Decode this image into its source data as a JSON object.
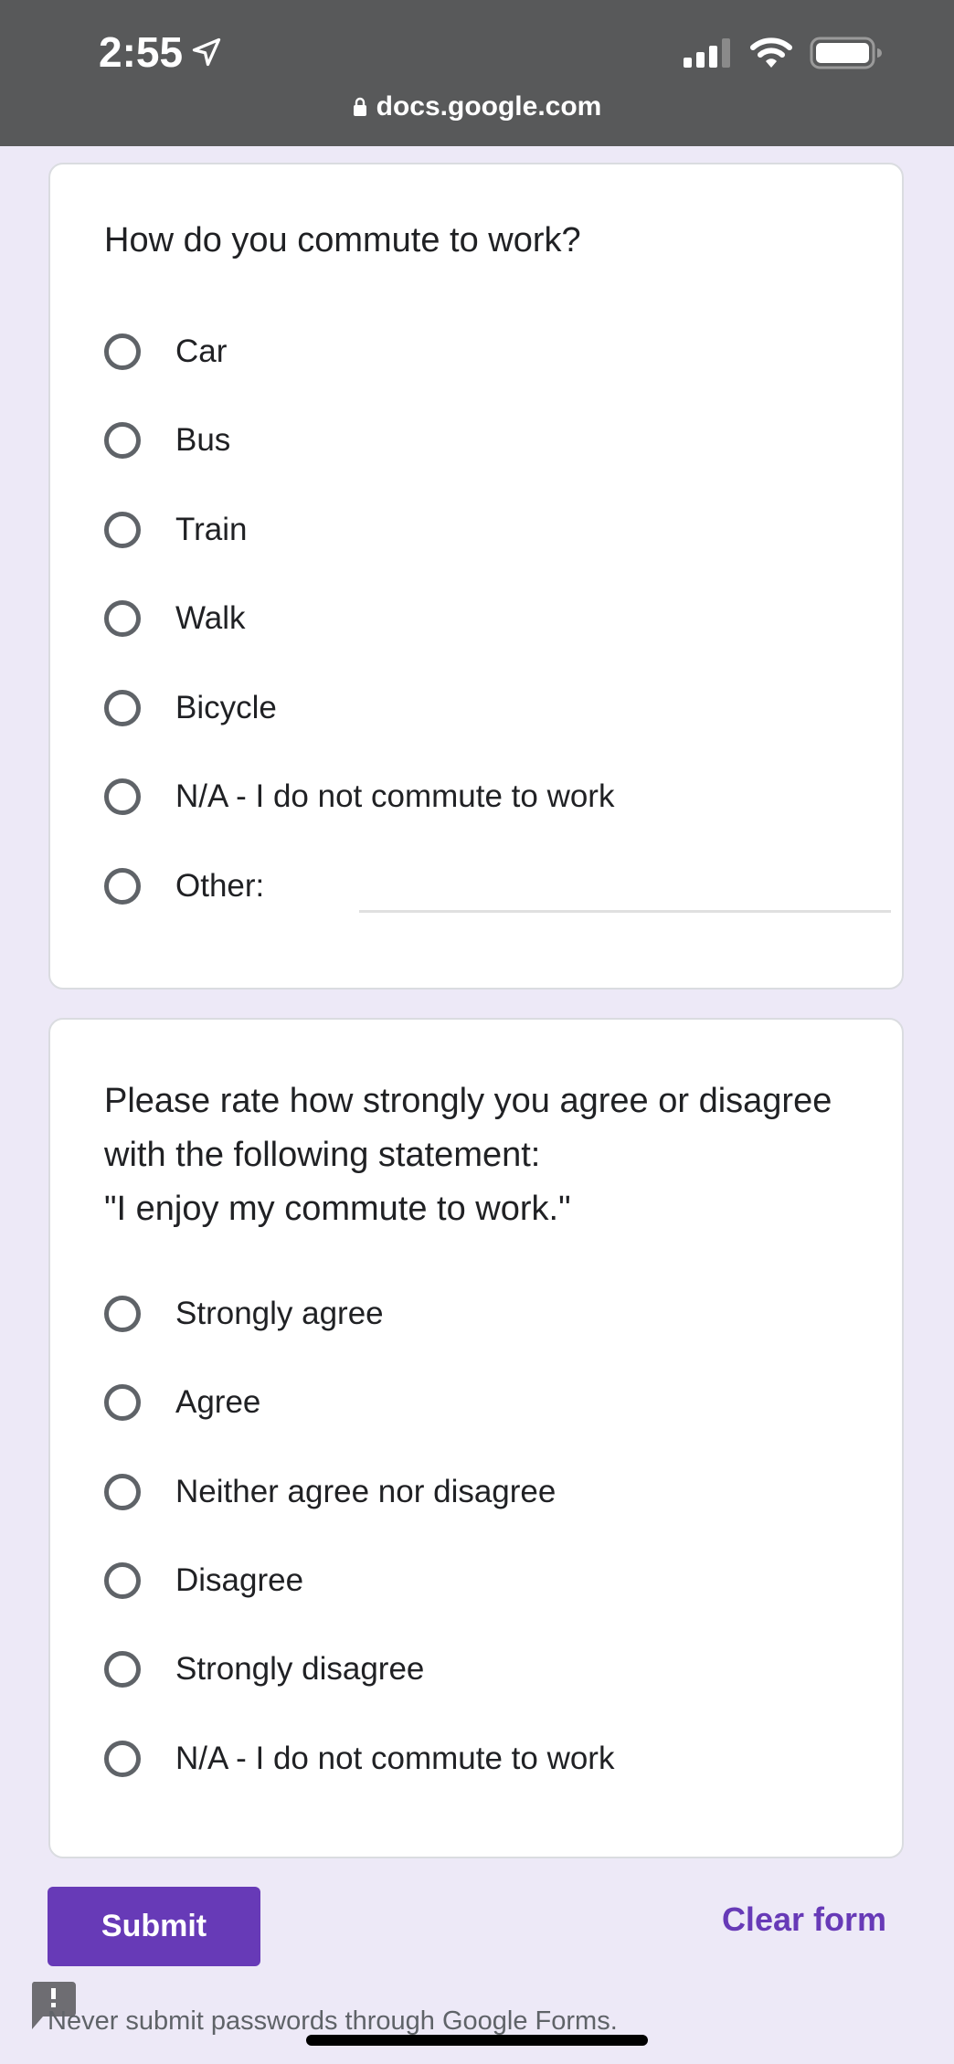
{
  "status_bar": {
    "time": "2:55",
    "location_icon": "location-arrow-icon",
    "signal_icon": "cellular-signal-icon",
    "signal_bars_active": 3,
    "signal_bars_total": 4,
    "wifi_icon": "wifi-icon",
    "battery_icon": "battery-icon",
    "url": "docs.google.com",
    "lock_icon": "lock-icon"
  },
  "questions": [
    {
      "title": "How do you commute to work?",
      "options": [
        "Car",
        "Bus",
        "Train",
        "Walk",
        "Bicycle",
        "N/A - I do not commute to work"
      ],
      "other_label": "Other:",
      "other_value": "",
      "other_placeholder": ""
    },
    {
      "title_lines": [
        "Please rate how strongly you agree or disagree",
        "with the following statement:",
        "\"I enjoy my commute to work.\""
      ],
      "options": [
        "Strongly agree",
        "Agree",
        "Neither agree nor disagree",
        "Disagree",
        "Strongly disagree",
        "N/A - I do not commute to work"
      ]
    }
  ],
  "actions": {
    "submit_label": "Submit",
    "clear_label": "Clear form"
  },
  "footer": {
    "warning_icon": "exclamation-feedback-icon",
    "warning_text": "Never submit passwords through Google Forms."
  },
  "colors": {
    "accent": "#673ab7",
    "page_background": "#ede9f7",
    "status_bar": "#58595a",
    "radio_border": "#5f6368"
  }
}
